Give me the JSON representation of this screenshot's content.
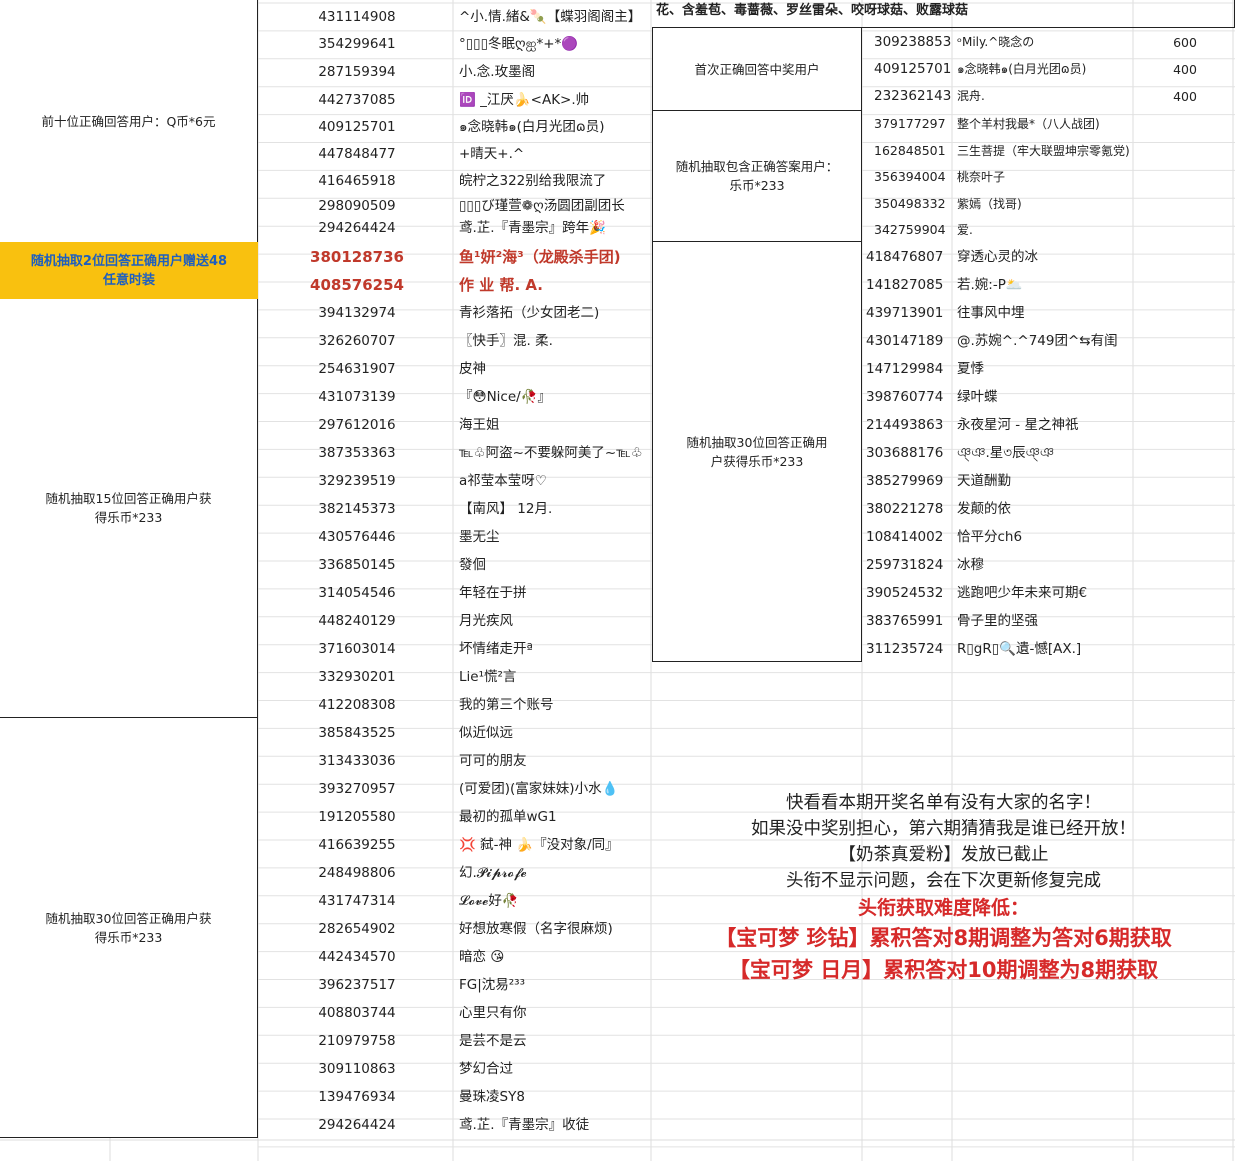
{
  "left_categories": [
    "前十位正确回答用户：Q币*6元",
    "随机抽取2位回答正确用户赠送48任意时装",
    "随机抽取15位回答正确用户获得乐币*233",
    "随机抽取30位回答正确用户获得乐币*233"
  ],
  "left_rows": [
    {
      "uid": "431114908",
      "name": "^小.情.緒&🍡【蝶羽阁阁主】"
    },
    {
      "uid": "354299641",
      "name": "°▯▯▯冬眠ღஐ*+*🟣"
    },
    {
      "uid": "287159394",
      "name": "小.念.玫墨阁"
    },
    {
      "uid": "442737085",
      "name": "🆔 _江厌🍌<AK>.帅"
    },
    {
      "uid": "409125701",
      "name": "๑念晓韩๑(白月光团ɷ员)"
    },
    {
      "uid": "447848477",
      "name": "+晴天+.^"
    },
    {
      "uid": "416465918",
      "name": "皖柠之322别给我限流了"
    },
    {
      "uid": "298090509",
      "name": "▯▯▯び瑾萱❁ღ汤圆团副团长"
    },
    {
      "uid": "294264424",
      "name": "鸢.芷.『青墨宗』跨年🎉"
    },
    {
      "uid": "380128736",
      "name": "鱼¹妍²海³（龙殿杀手团)"
    },
    {
      "uid": "408576254",
      "name": "作 业 帮. A."
    },
    {
      "uid": "394132974",
      "name": "青衫落拓（少女团老二)"
    },
    {
      "uid": "326260707",
      "name": "〖快手〗混. 柔."
    },
    {
      "uid": "254631907",
      "name": "皮神"
    },
    {
      "uid": "431073139",
      "name": "『😳Nice/🥀』"
    },
    {
      "uid": "297612016",
      "name": "海王姐"
    },
    {
      "uid": "387353363",
      "name": "℡♧阿盗~不要躲阿美了~℡♧"
    },
    {
      "uid": "329239519",
      "name": "a祁莹本莹呀♡"
    },
    {
      "uid": "382145373",
      "name": "【南风】 12月."
    },
    {
      "uid": "430576446",
      "name": "墨无尘"
    },
    {
      "uid": "336850145",
      "name": "發佪"
    },
    {
      "uid": "314054546",
      "name": "年轻在于拼"
    },
    {
      "uid": "448240129",
      "name": "月光疾风"
    },
    {
      "uid": "371603014",
      "name": "坏情绪走开ª"
    },
    {
      "uid": "332930201",
      "name": "Lie¹慌²言"
    },
    {
      "uid": "412208308",
      "name": "我的第三个账号"
    },
    {
      "uid": "385843525",
      "name": "似近似远"
    },
    {
      "uid": "313433036",
      "name": "可可的朋友"
    },
    {
      "uid": "393270957",
      "name": "(可爱团)(富家妹妹)小水💧"
    },
    {
      "uid": "191205580",
      "name": "最初的孤单wG1"
    },
    {
      "uid": "416639255",
      "name": "💢 弑-神 🍌『没对象/同』"
    },
    {
      "uid": "248498806",
      "name": "幻.𝓟𝓲𝓹𝓻𝓸𝓯𝓮"
    },
    {
      "uid": "431747314",
      "name": "𝓛𝓸𝓿𝓮好🥀"
    },
    {
      "uid": "282654902",
      "name": "好想放寒假（名字很麻烦)"
    },
    {
      "uid": "442434570",
      "name": "暗恋 😘"
    },
    {
      "uid": "396237517",
      "name": "FG|沈易²³³"
    },
    {
      "uid": "408803744",
      "name": "心里只有你"
    },
    {
      "uid": "210979758",
      "name": "是芸不是云"
    },
    {
      "uid": "309110863",
      "name": "梦幻合过"
    },
    {
      "uid": "139476934",
      "name": "曼珠凌SY8"
    },
    {
      "uid": "294264424",
      "name": "鸢.芷.『青墨宗』收徒"
    }
  ],
  "right_top_text": "花、含羞苞、毒蔷薇、罗丝雷朵、咬呀球菇、败露球菇",
  "right_categories": [
    "首次正确回答中奖用户",
    "随机抽取包含正确答案用户：乐币*233",
    "随机抽取30位回答正确用户获得乐币*233"
  ],
  "right_rows_first": [
    {
      "uid": "309238853",
      "name": "ᵒMily.^晓念の",
      "amount": "600"
    },
    {
      "uid": "409125701",
      "name": "๑念晓韩๑(白月光团ɷ员)",
      "amount": "400"
    },
    {
      "uid": "232362143",
      "name": "泯舟.",
      "amount": "400"
    }
  ],
  "right_rows_small": [
    {
      "uid": "379177297",
      "name": "整个羊村我最*（八人战团)"
    },
    {
      "uid": "162848501",
      "name": "三生菩提（牢大联盟坤宗零氪党)"
    },
    {
      "uid": "356394004",
      "name": "桃奈叶子"
    },
    {
      "uid": "350498332",
      "name": "紫嫣（找哥)"
    },
    {
      "uid": "342759904",
      "name": "爱."
    }
  ],
  "right_rows_30": [
    {
      "uid": "418476807",
      "name": "穿透心灵的冰"
    },
    {
      "uid": "141827085",
      "name": "若.婉:-P🌥️"
    },
    {
      "uid": "439713901",
      "name": "往事风中埋"
    },
    {
      "uid": "430147189",
      "name": "@.苏婉^.^749团^⇆有闺"
    },
    {
      "uid": "147129984",
      "name": "夏悸"
    },
    {
      "uid": "398760774",
      "name": "绿叶蝶"
    },
    {
      "uid": "214493863",
      "name": "永夜星河 - 星之神祇"
    },
    {
      "uid": "303688176",
      "name": "ঞ্ঞ.星৩辰ঞ্ঞ"
    },
    {
      "uid": "385279969",
      "name": "天道酬勤"
    },
    {
      "uid": "380221278",
      "name": "发颠的依"
    },
    {
      "uid": "108414002",
      "name": "恰平分ch6"
    },
    {
      "uid": "259731824",
      "name": "冰穆"
    },
    {
      "uid": "390524532",
      "name": "逃跑吧少年未来可期€"
    },
    {
      "uid": "383765991",
      "name": "骨子里的坚强"
    },
    {
      "uid": "311235724",
      "name": "R▯gR▯🔍遺-憾[AX.]"
    }
  ],
  "notice": {
    "lines": [
      "快看看本期开奖名单有没有大家的名字！",
      "如果没中奖别担心，第六期猜猜我是谁已经开放！",
      "【奶茶真爱粉】发放已截止",
      "头衔不显示问题，会在下次更新修复完成"
    ],
    "red_lines": [
      "头衔获取难度降低：",
      "【宝可梦 珍钻】累积答对8期调整为答对6期获取",
      "【宝可梦 日月】累积答对10期调整为8期获取"
    ]
  },
  "colors": {
    "highlight_bg": "#f9c10f",
    "highlight_text": "#1e5fbf",
    "red": "#d62a2a",
    "grid": "#d8d8d8"
  }
}
